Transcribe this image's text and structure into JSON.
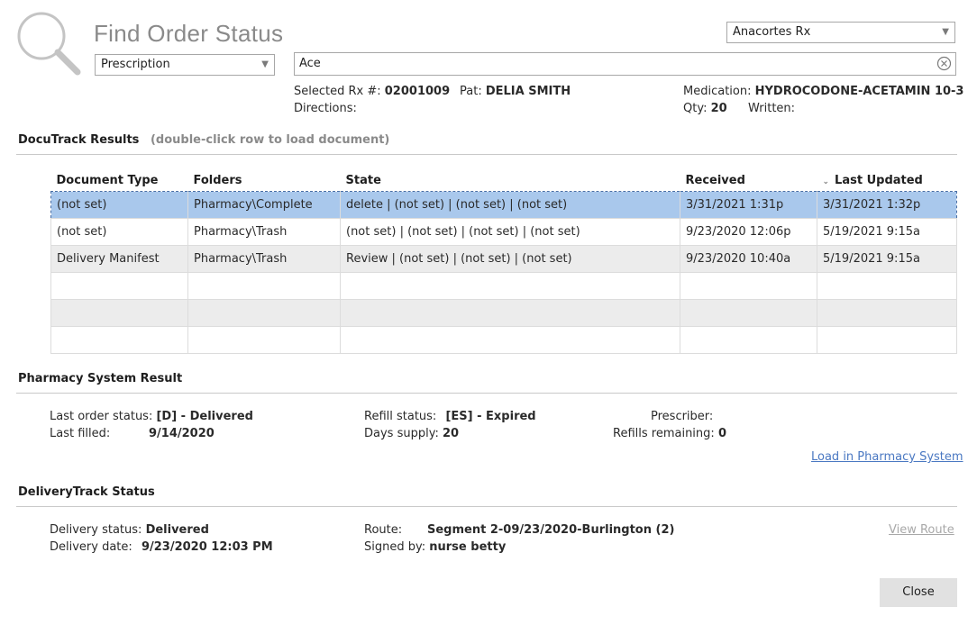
{
  "header": {
    "title": "Find Order Status",
    "store": "Anacortes Rx",
    "search_type": "Prescription",
    "search_value": "Ace"
  },
  "selected": {
    "rx_label": "Selected Rx #:",
    "rx_value": "02001009",
    "pat_label": "Pat:",
    "pat_value": "DELIA SMITH",
    "directions_label": "Directions:",
    "medication_label": "Medication:",
    "medication_value": "HYDROCODONE-ACETAMIN 10-3",
    "qty_label": "Qty:",
    "qty_value": "20",
    "written_label": "Written:"
  },
  "docutrack": {
    "title": "DocuTrack Results",
    "hint": "(double-click row to load document)",
    "columns": [
      "Document Type",
      "Folders",
      "State",
      "Received",
      "Last Updated"
    ],
    "rows": [
      [
        "(not set)",
        "Pharmacy\\Complete",
        "delete | (not set) | (not set) | (not set)",
        "3/31/2021 1:31p",
        "3/31/2021 1:32p"
      ],
      [
        "(not set)",
        "Pharmacy\\Trash",
        "(not set) | (not set) | (not set) | (not set)",
        "9/23/2020 12:06p",
        "5/19/2021 9:15a"
      ],
      [
        "Delivery Manifest",
        "Pharmacy\\Trash",
        "Review | (not set) | (not set) | (not set)",
        "9/23/2020 10:40a",
        "5/19/2021 9:15a"
      ]
    ]
  },
  "pharmacy": {
    "title": "Pharmacy System Result",
    "last_order_label": "Last order status:",
    "last_order_value": "[D] - Delivered",
    "last_filled_label": "Last filled:",
    "last_filled_value": "9/14/2020",
    "refill_status_label": "Refill status:",
    "refill_status_value": "[ES] - Expired",
    "days_supply_label": "Days supply:",
    "days_supply_value": "20",
    "prescriber_label": "Prescriber:",
    "refills_label": "Refills remaining:",
    "refills_value": "0",
    "load_link": "Load in Pharmacy System"
  },
  "delivery": {
    "title": "DeliveryTrack Status",
    "status_label": "Delivery status:",
    "status_value": "Delivered",
    "date_label": "Delivery date:",
    "date_value": "9/23/2020 12:03 PM",
    "route_label": "Route:",
    "route_value": "Segment 2-09/23/2020-Burlington (2)",
    "signed_label": "Signed by:",
    "signed_value": "nurse betty",
    "view_route": "View Route"
  },
  "footer": {
    "close": "Close"
  }
}
